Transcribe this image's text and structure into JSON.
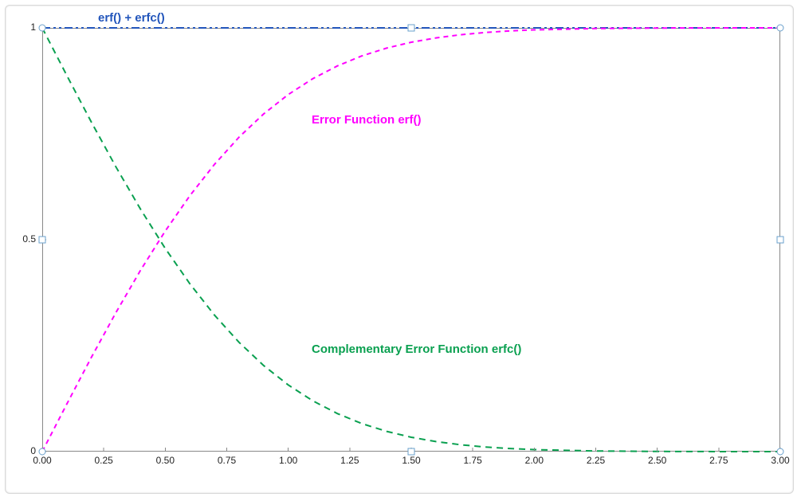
{
  "chart_data": {
    "type": "line",
    "x": [
      0.0,
      0.1,
      0.2,
      0.3,
      0.4,
      0.5,
      0.6,
      0.7,
      0.8,
      0.9,
      1.0,
      1.1,
      1.2,
      1.3,
      1.4,
      1.5,
      1.6,
      1.7,
      1.8,
      1.9,
      2.0,
      2.25,
      2.5,
      2.75,
      3.0
    ],
    "series": [
      {
        "name": "erf()",
        "values": [
          0.0,
          0.1125,
          0.2227,
          0.3286,
          0.4284,
          0.5205,
          0.6039,
          0.6778,
          0.7421,
          0.7969,
          0.8427,
          0.8802,
          0.9103,
          0.934,
          0.9523,
          0.9661,
          0.9763,
          0.9838,
          0.9891,
          0.9928,
          0.9953,
          0.99854,
          0.99959,
          0.9999,
          0.99998
        ]
      },
      {
        "name": "erfc()",
        "values": [
          1.0,
          0.8875,
          0.7773,
          0.6714,
          0.5716,
          0.4795,
          0.3961,
          0.3222,
          0.2579,
          0.2031,
          0.1573,
          0.1198,
          0.0897,
          0.066,
          0.0477,
          0.0339,
          0.0237,
          0.0162,
          0.0109,
          0.0072,
          0.0047,
          0.00146,
          0.00041,
          0.0001,
          2e-05
        ]
      },
      {
        "name": "erf()+erfc()",
        "values": [
          1,
          1,
          1,
          1,
          1,
          1,
          1,
          1,
          1,
          1,
          1,
          1,
          1,
          1,
          1,
          1,
          1,
          1,
          1,
          1,
          1,
          1,
          1,
          1,
          1
        ]
      }
    ],
    "xlabel": "",
    "ylabel": "",
    "xlim": [
      0.0,
      3.0
    ],
    "ylim": [
      0.0,
      1.0
    ],
    "x_ticks": [
      "0.00",
      "0.25",
      "0.50",
      "0.75",
      "1.00",
      "1.25",
      "1.50",
      "1.75",
      "2.00",
      "2.25",
      "2.50",
      "2.75",
      "3.00"
    ],
    "y_ticks": [
      "0",
      "0.5",
      "1"
    ],
    "annotations": {
      "erf": "Error Function  erf()",
      "erfc": "Complementary  Error Function  erfc()",
      "sum": "erf() + erfc()"
    },
    "colors": {
      "erf": "#ff00ff",
      "erfc": "#0aa050",
      "sum": "#2255bb"
    }
  }
}
